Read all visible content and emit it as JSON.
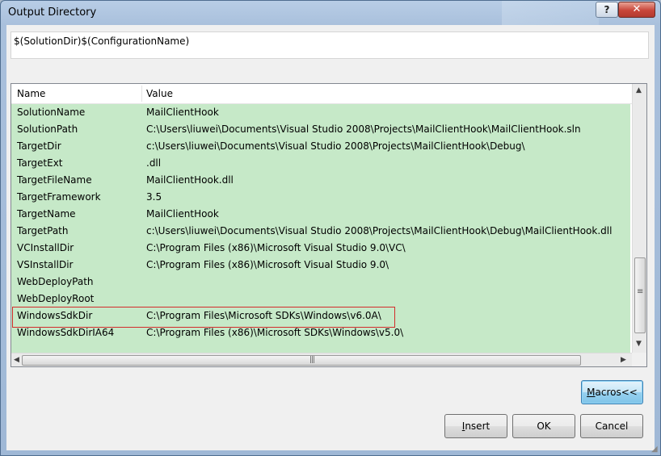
{
  "window": {
    "title": "Output Directory",
    "help_label": "?",
    "close_label": "✕"
  },
  "path_value": "$(SolutionDir)$(ConfigurationName)",
  "list": {
    "columns": {
      "name": "Name",
      "value": "Value"
    },
    "rows": [
      {
        "name": "SolutionName",
        "value": "MailClientHook"
      },
      {
        "name": "SolutionPath",
        "value": "C:\\Users\\liuwei\\Documents\\Visual Studio 2008\\Projects\\MailClientHook\\MailClientHook.sln"
      },
      {
        "name": "TargetDir",
        "value": "c:\\Users\\liuwei\\Documents\\Visual Studio 2008\\Projects\\MailClientHook\\Debug\\"
      },
      {
        "name": "TargetExt",
        "value": ".dll"
      },
      {
        "name": "TargetFileName",
        "value": "MailClientHook.dll"
      },
      {
        "name": "TargetFramework",
        "value": "3.5"
      },
      {
        "name": "TargetName",
        "value": "MailClientHook"
      },
      {
        "name": "TargetPath",
        "value": "c:\\Users\\liuwei\\Documents\\Visual Studio 2008\\Projects\\MailClientHook\\Debug\\MailClientHook.dll"
      },
      {
        "name": "VCInstallDir",
        "value": "C:\\Program Files (x86)\\Microsoft Visual Studio 9.0\\VC\\"
      },
      {
        "name": "VSInstallDir",
        "value": "C:\\Program Files (x86)\\Microsoft Visual Studio 9.0\\"
      },
      {
        "name": "WebDeployPath",
        "value": ""
      },
      {
        "name": "WebDeployRoot",
        "value": ""
      },
      {
        "name": "WindowsSdkDir",
        "value": "C:\\Program Files\\Microsoft SDKs\\Windows\\v6.0A\\"
      },
      {
        "name": "WindowsSdkDirIA64",
        "value": "C:\\Program Files (x86)\\Microsoft SDKs\\Windows\\v5.0\\"
      }
    ],
    "highlighted_row": "WindowsSdkDir",
    "row_background": "#c6e9c8",
    "highlight_color": "#d32b2b"
  },
  "scrollbar": {
    "grip": "≡",
    "hgrip": "|||"
  },
  "buttons": {
    "macros": {
      "mnemonic": "M",
      "rest": "acros<<"
    },
    "insert": {
      "mnemonic": "I",
      "rest": "nsert"
    },
    "ok": "OK",
    "cancel": "Cancel"
  }
}
